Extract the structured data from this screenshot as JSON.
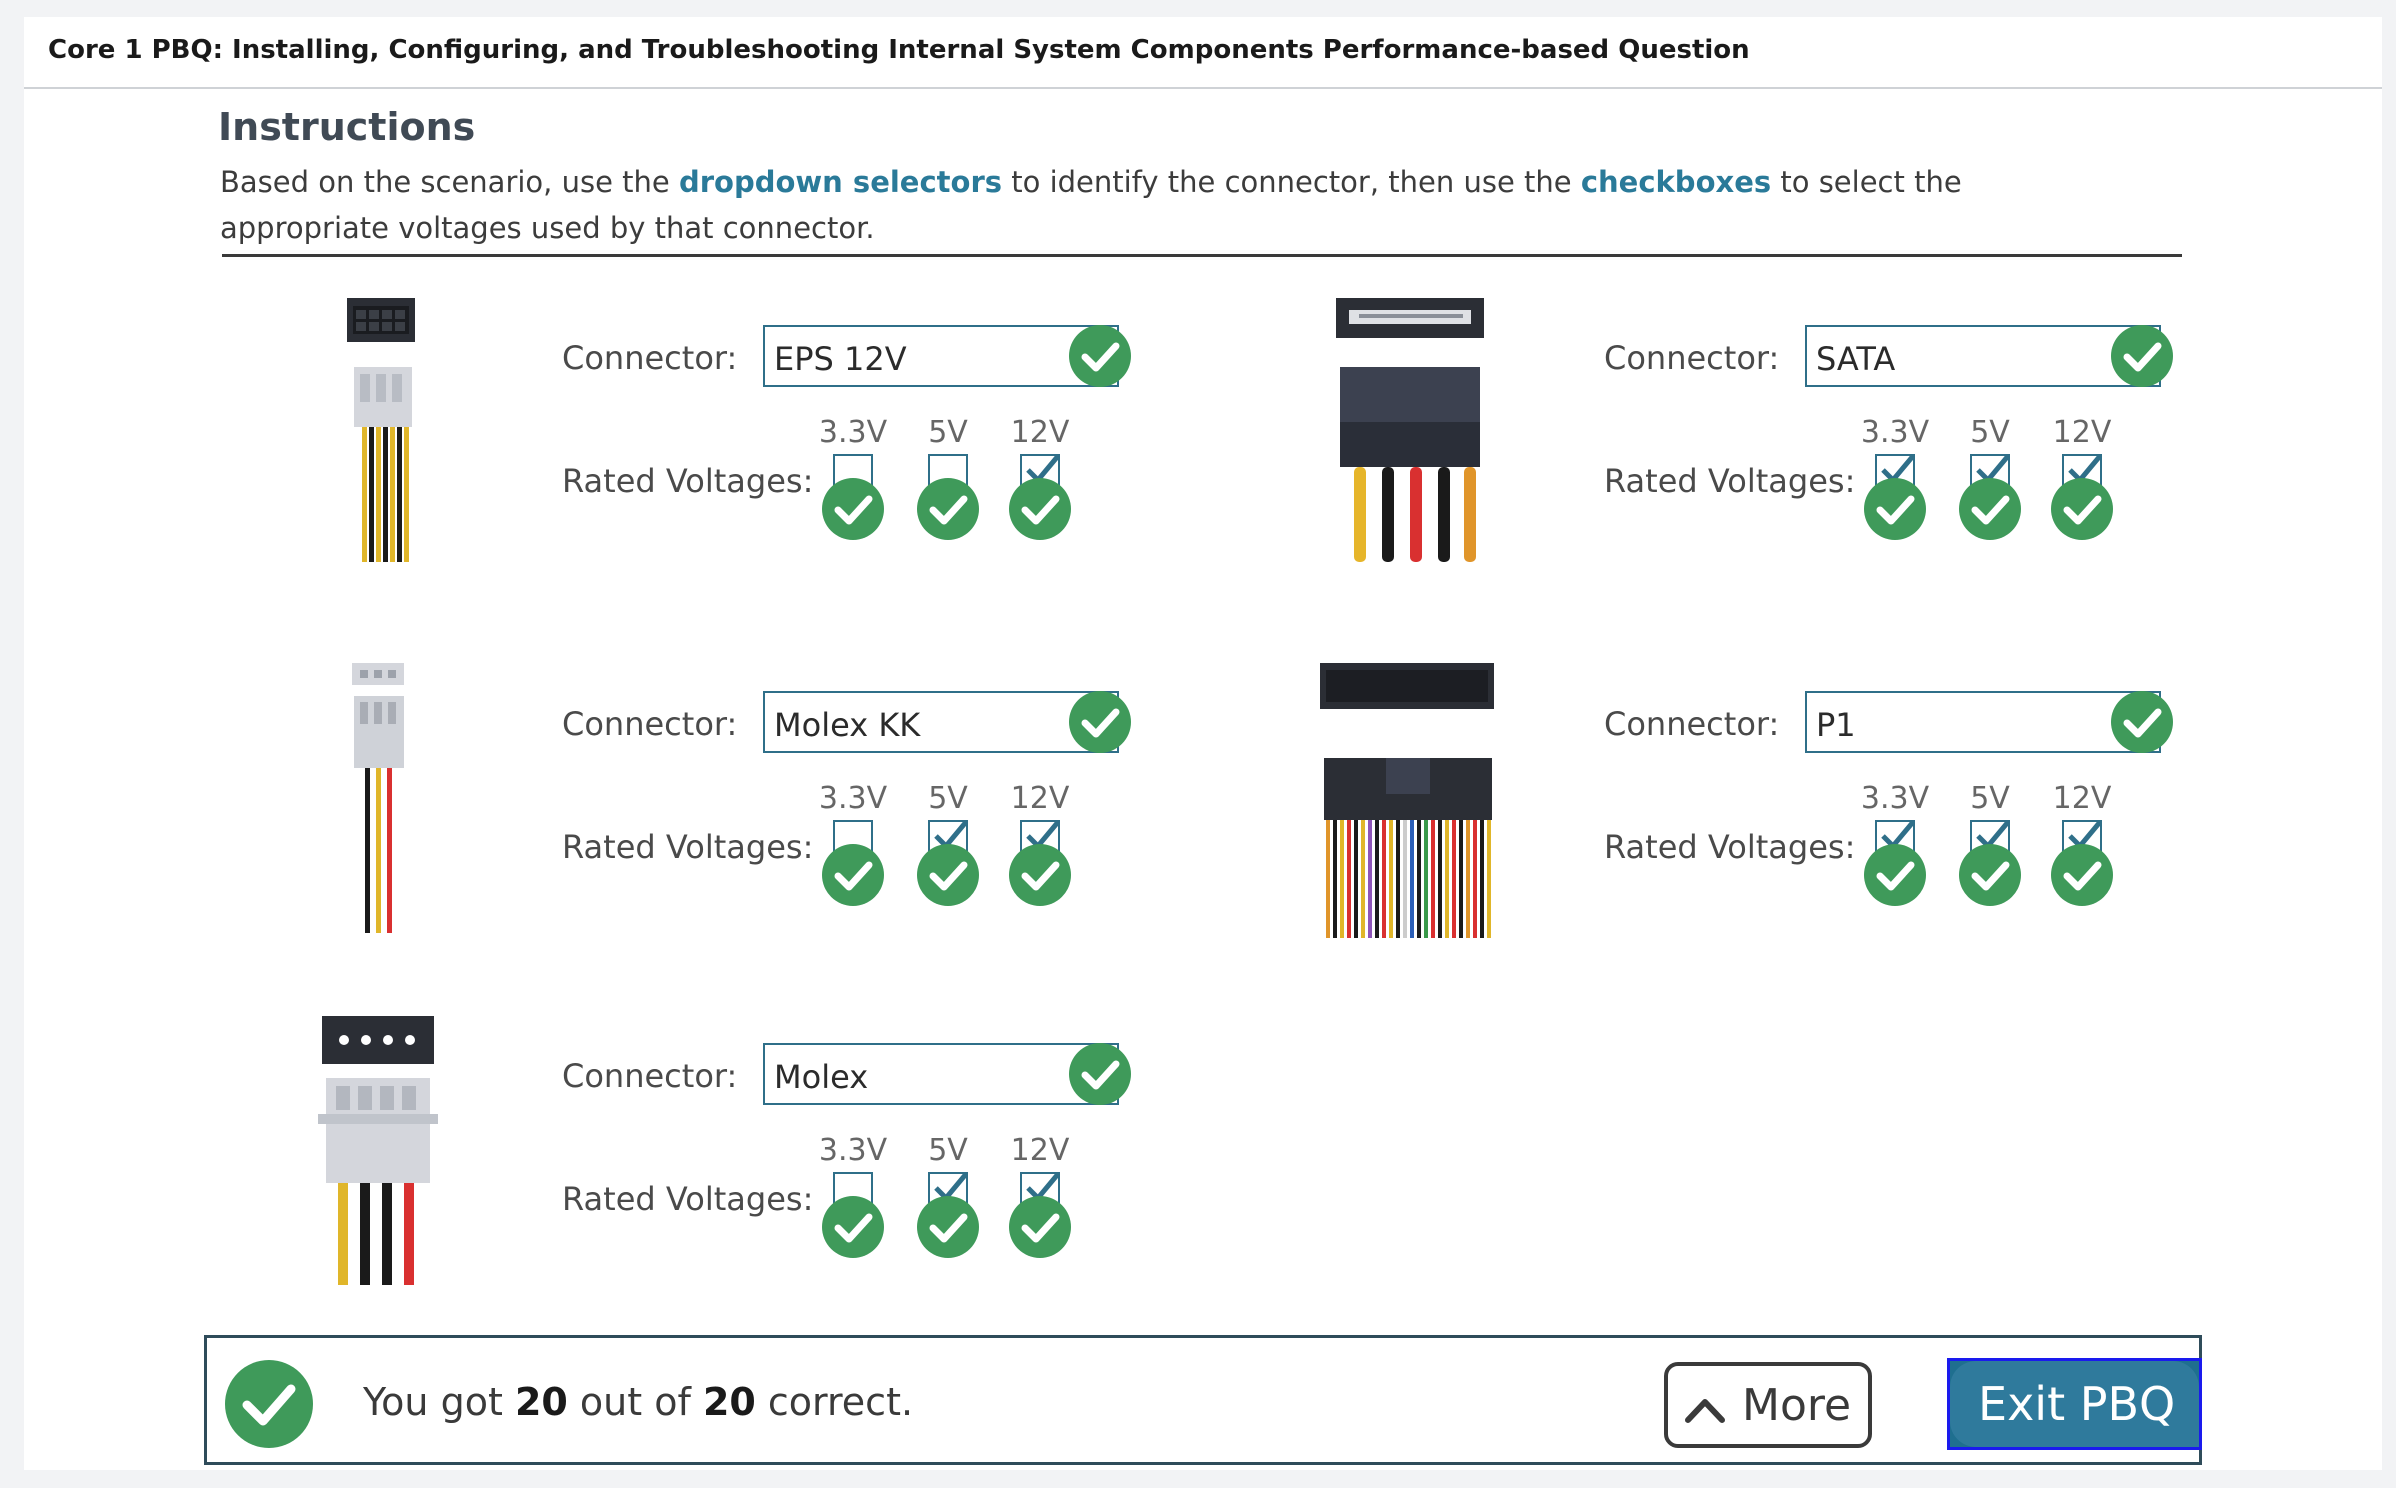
{
  "header": {
    "title": "Core 1 PBQ: Installing, Configuring, and Troubleshooting Internal System Components Performance-based Question"
  },
  "instructions": {
    "heading": "Instructions",
    "text_1": "Based on the scenario, use the ",
    "highlight_1": "dropdown selectors",
    "text_2": " to identify the connector, then use the ",
    "highlight_2": "checkboxes",
    "text_3": " to select the appropriate voltages used by that connector."
  },
  "labels": {
    "connector": "Connector:",
    "rated_voltages": "Rated Voltages:",
    "v33": "3.3V",
    "v5": "5V",
    "v12": "12V"
  },
  "connectors": [
    {
      "image": "eps-12v-connector",
      "selected": "EPS 12V",
      "checked": [
        false,
        false,
        true
      ],
      "all_correct": true
    },
    {
      "image": "sata-connector",
      "selected": "SATA",
      "checked": [
        true,
        true,
        true
      ],
      "all_correct": true
    },
    {
      "image": "molex-kk-connector",
      "selected": "Molex KK",
      "checked": [
        false,
        true,
        true
      ],
      "all_correct": true
    },
    {
      "image": "p1-connector",
      "selected": "P1",
      "checked": [
        true,
        true,
        true
      ],
      "all_correct": true
    },
    {
      "image": "molex-connector",
      "selected": "Molex",
      "checked": [
        false,
        true,
        true
      ],
      "all_correct": true
    }
  ],
  "result": {
    "prefix": "You got ",
    "score": "20",
    "middle": " out of ",
    "total": "20",
    "suffix": " correct."
  },
  "buttons": {
    "more": "More",
    "exit": "Exit PBQ"
  },
  "colors": {
    "correct_green": "#3f9a5a",
    "accent_blue": "#2f7a9c",
    "highlight_text": "#2a7a99"
  }
}
